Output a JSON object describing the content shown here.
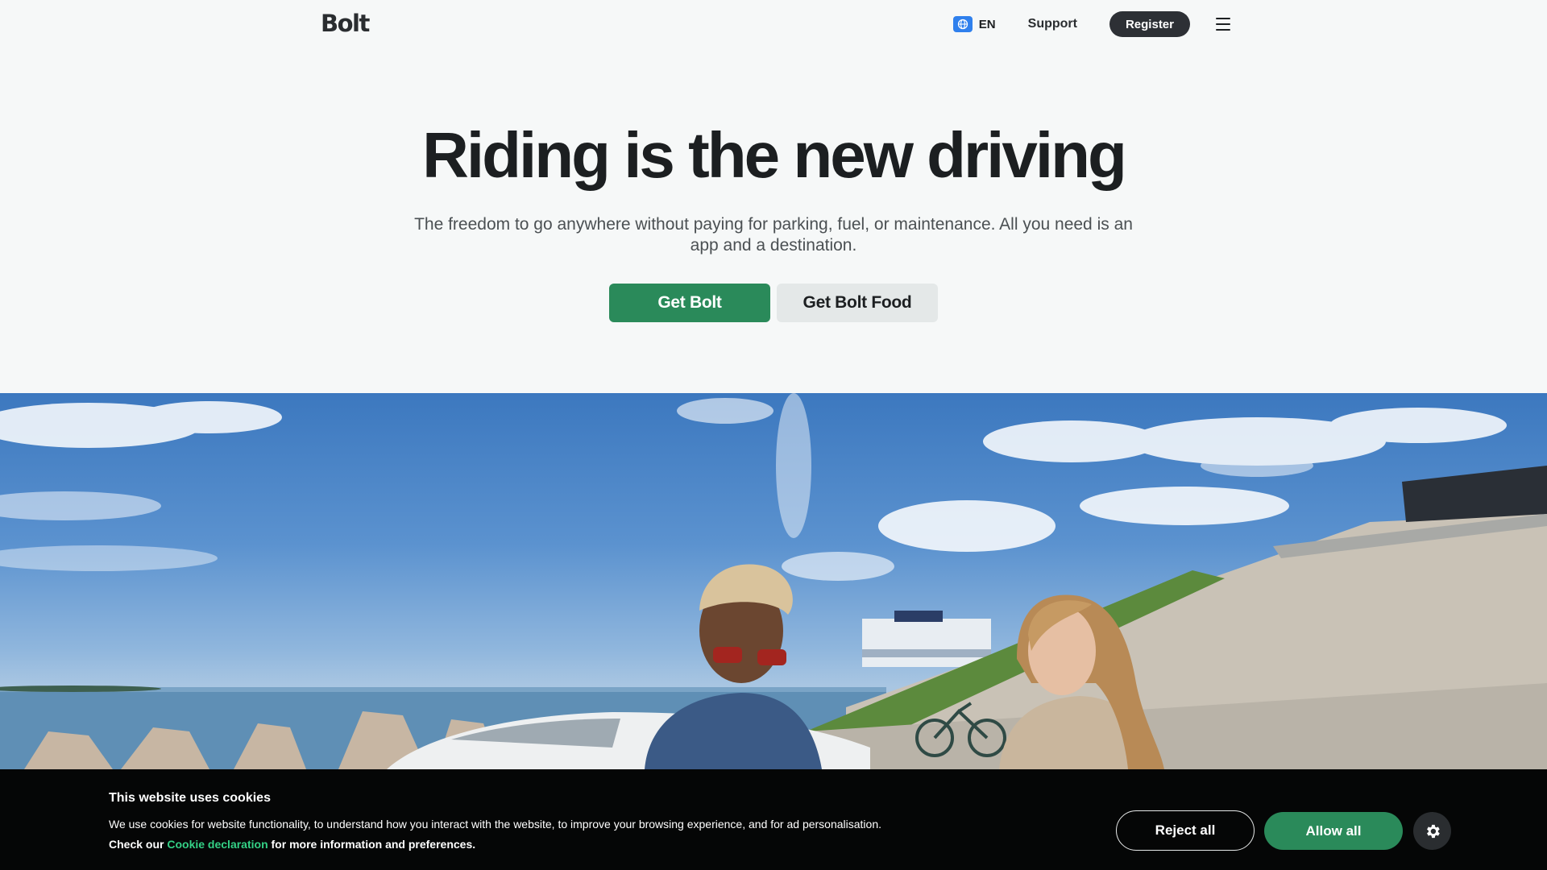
{
  "header": {
    "logo": "Bolt",
    "language": "EN",
    "support_label": "Support",
    "register_label": "Register"
  },
  "hero": {
    "title": "Riding is the new driving",
    "subtitle": "The freedom to go anywhere without paying for parking, fuel, or maintenance. All you need is an app and a destination.",
    "primary_button": "Get Bolt",
    "secondary_button": "Get Bolt Food"
  },
  "cookie_banner": {
    "title": "This website uses cookies",
    "text_line1": "We use cookies for website functionality, to understand how you interact with the website, to improve your browsing experience, and for ad personalisation.",
    "text_prefix": "Check our",
    "link_label": "Cookie declaration",
    "text_suffix": "for more information and preferences.",
    "reject_label": "Reject all",
    "allow_label": "Allow all"
  },
  "icons": {
    "language": "globe-icon",
    "menu": "hamburger-menu-icon",
    "settings": "gear-icon"
  },
  "colors": {
    "brand_green": "#2a8a5a",
    "link_green": "#34d186",
    "dark_button": "#2d3035",
    "background": "#f6f8f8"
  }
}
